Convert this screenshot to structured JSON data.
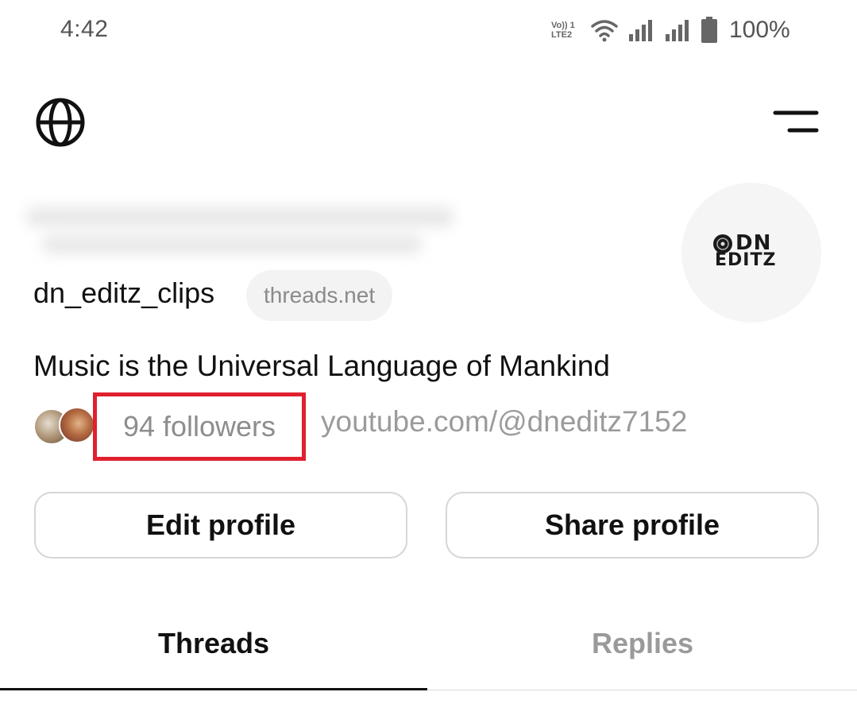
{
  "status_bar": {
    "time": "4:42",
    "volte_label_top": "Vo)) 1",
    "volte_label_bottom": "LTE2",
    "battery_text": "100%",
    "icons": [
      "volte-icon",
      "wifi-icon",
      "signal-icon",
      "signal-icon",
      "battery-icon"
    ]
  },
  "header": {
    "left_icon": "globe-icon",
    "right_icon": "menu-icon"
  },
  "profile": {
    "username": "dn_editz_clips",
    "domain_badge": "threads.net",
    "bio": "Music is the Universal Language of Mankind",
    "followers": "94 followers",
    "link": "youtube.com/@dneditz7152",
    "avatar_logo_line1": "DN",
    "avatar_logo_line2": "EDITZ"
  },
  "actions": {
    "edit_profile": "Edit profile",
    "share_profile": "Share profile"
  },
  "tabs": [
    {
      "label": "Threads",
      "active": true
    },
    {
      "label": "Replies",
      "active": false
    }
  ],
  "colors": {
    "highlight_border": "#e0202e",
    "muted_text": "#8d8d8d",
    "primary_text": "#111111"
  }
}
